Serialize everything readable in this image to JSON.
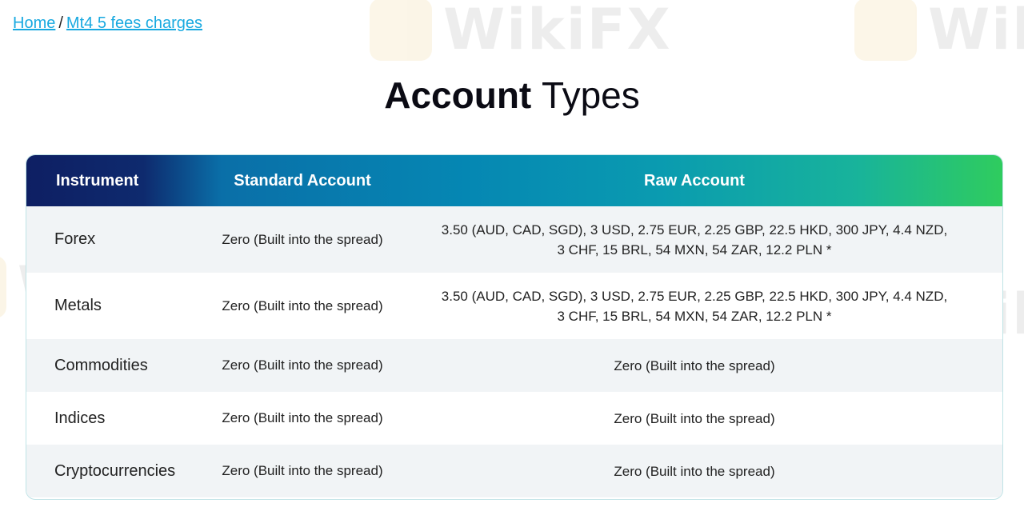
{
  "breadcrumb": {
    "home": "Home",
    "separator": "/",
    "current": "Mt4 5 fees charges"
  },
  "title": {
    "bold": "Account",
    "light": "Types"
  },
  "watermark": {
    "text": "WikiFX"
  },
  "table": {
    "headers": [
      "Instrument",
      "Standard Account",
      "Raw Account"
    ],
    "rows": [
      {
        "instrument": "Forex",
        "standard": "Zero (Built into the spread)",
        "raw_line1": "3.50 (AUD, CAD, SGD), 3 USD, 2.75 EUR, 2.25 GBP, 22.5 HKD, 300 JPY, 4.4 NZD,",
        "raw_line2": "3 CHF, 15 BRL, 54 MXN, 54 ZAR, 12.2 PLN *"
      },
      {
        "instrument": "Metals",
        "standard": "Zero (Built into the spread)",
        "raw_line1": "3.50 (AUD, CAD, SGD), 3 USD, 2.75 EUR, 2.25 GBP, 22.5 HKD, 300 JPY, 4.4 NZD,",
        "raw_line2": "3 CHF, 15 BRL, 54 MXN, 54 ZAR, 12.2 PLN *"
      },
      {
        "instrument": "Commodities",
        "standard": "Zero (Built into the spread)",
        "raw_line1": "Zero (Built into the spread)",
        "raw_line2": ""
      },
      {
        "instrument": "Indices",
        "standard": "Zero (Built into the spread)",
        "raw_line1": "Zero (Built into the spread)",
        "raw_line2": ""
      },
      {
        "instrument": "Cryptocurrencies",
        "standard": "Zero (Built into the spread)",
        "raw_line1": "Zero (Built into the spread)",
        "raw_line2": ""
      }
    ]
  },
  "colors": {
    "link": "#18a9e0",
    "header_gradient_start": "#0e1f63",
    "header_gradient_end": "#2fcc5e",
    "row_alt": "#f1f4f6"
  }
}
